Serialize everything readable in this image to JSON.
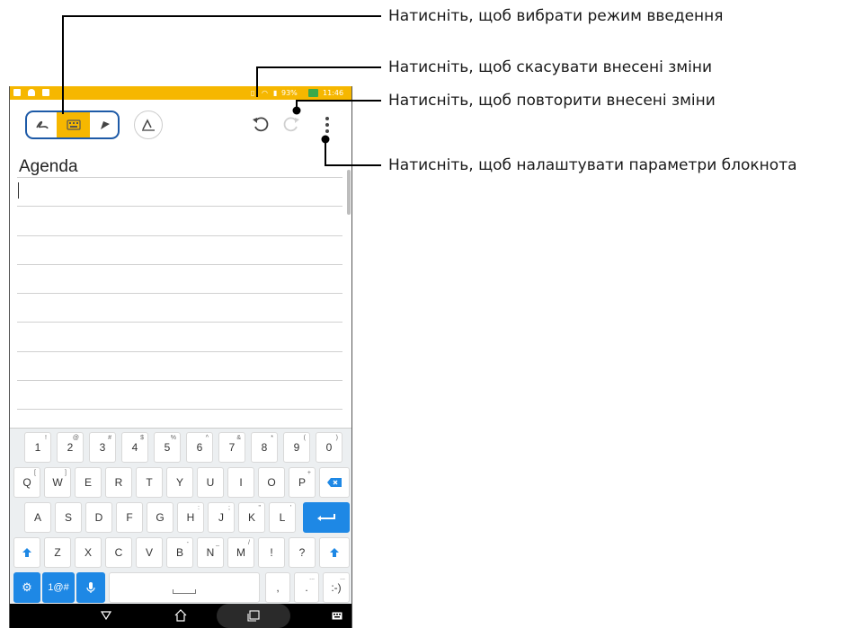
{
  "status_bar": {
    "battery": "93%",
    "time": "11:46"
  },
  "toolbar": {
    "modes": [
      {
        "name": "handwriting-mode",
        "icon": "handwriting-icon"
      },
      {
        "name": "keyboard-mode",
        "icon": "keyboard-icon"
      },
      {
        "name": "pen-mode",
        "icon": "pen-icon"
      }
    ],
    "selected_mode": "keyboard-mode",
    "actions": [
      "text-style-icon",
      "undo-icon",
      "redo-icon",
      "more-vert-icon"
    ]
  },
  "callouts": [
    "Натисніть, щоб вибрати режим введення",
    "Натисніть, щоб скасувати внесені зміни",
    "Натисніть, щоб повторити внесені зміни",
    "Натисніть, щоб налаштувати параметри блокнота"
  ],
  "note": {
    "title": "Agenda"
  },
  "keyboard": {
    "rows": [
      [
        [
          "1",
          "!"
        ],
        [
          "2",
          "@"
        ],
        [
          "3",
          "#"
        ],
        [
          "4",
          "$"
        ],
        [
          "5",
          "%"
        ],
        [
          "6",
          "^"
        ],
        [
          "7",
          "&"
        ],
        [
          "8",
          "*"
        ],
        [
          "9",
          "("
        ],
        [
          "0",
          ")"
        ]
      ],
      [
        [
          "Q",
          "["
        ],
        [
          "W",
          "]"
        ],
        [
          "E",
          ""
        ],
        [
          "R",
          ""
        ],
        [
          "T",
          ""
        ],
        [
          "Y",
          ""
        ],
        [
          "U",
          ""
        ],
        [
          "I",
          ""
        ],
        [
          "O",
          ""
        ],
        [
          "P",
          "+"
        ]
      ],
      [
        [
          "A",
          ""
        ],
        [
          "S",
          ""
        ],
        [
          "D",
          ""
        ],
        [
          "F",
          ""
        ],
        [
          "G",
          ""
        ],
        [
          "H",
          ":"
        ],
        [
          "J",
          ";"
        ],
        [
          "K",
          "\""
        ],
        [
          "L",
          "'"
        ]
      ],
      [
        [
          "Z",
          ""
        ],
        [
          "X",
          ""
        ],
        [
          "C",
          ""
        ],
        [
          "V",
          ""
        ],
        [
          "B",
          "-"
        ],
        [
          "N",
          "_"
        ],
        [
          "M",
          "/"
        ],
        [
          "!",
          ""
        ],
        [
          "?",
          ""
        ]
      ],
      [
        [
          "1@#",
          ""
        ],
        [
          ",",
          ""
        ],
        [
          ".",
          "..."
        ],
        [
          ":-)",
          "..."
        ]
      ]
    ]
  },
  "colors": {
    "accent": "#f6b700",
    "mode_border": "#1d5aa7",
    "key_blue": "#1e88e5",
    "callout_line": "#000000"
  }
}
